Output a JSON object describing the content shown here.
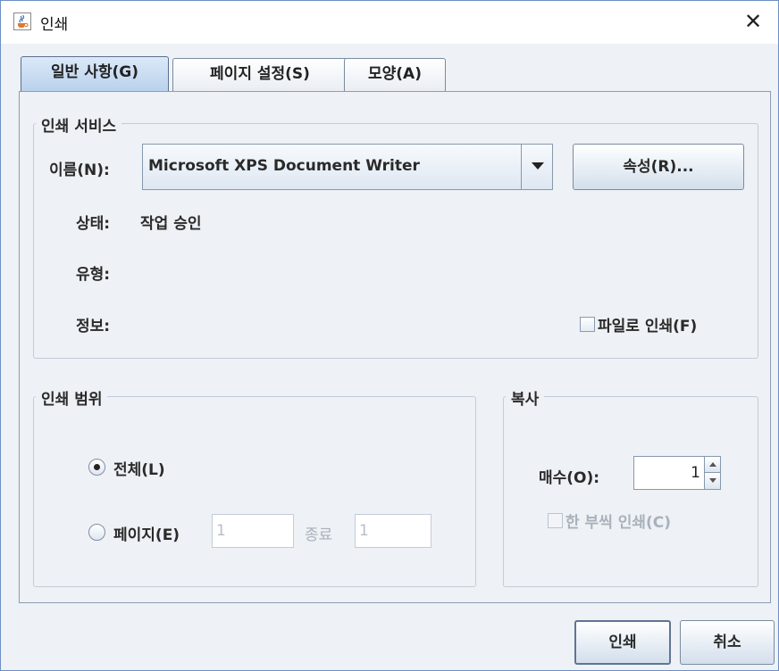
{
  "window": {
    "title": "인쇄",
    "close_symbol": "✕"
  },
  "tabs": [
    {
      "label": "일반 사항(G)",
      "active": true
    },
    {
      "label": "페이지 설정(S)",
      "active": false
    },
    {
      "label": "모양(A)",
      "active": false
    }
  ],
  "print_service": {
    "group_title": "인쇄 서비스",
    "name_label": "이름(N):",
    "printer_name": "Microsoft XPS Document Writer",
    "properties_button": "속성(R)...",
    "status_label": "상태:",
    "status_value": "작업 승인",
    "type_label": "유형:",
    "info_label": "정보:",
    "print_to_file_label": "파일로 인쇄(F)",
    "print_to_file_checked": false
  },
  "print_range": {
    "group_title": "인쇄 범위",
    "all_label": "전체(L)",
    "all_selected": true,
    "pages_label": "페이지(E)",
    "from_value": "1",
    "to_label": "종료",
    "to_value": "1"
  },
  "copies": {
    "group_title": "복사",
    "count_label": "매수(O):",
    "count_value": "1",
    "collate_label": "한 부씩 인쇄(C)",
    "collate_checked": false
  },
  "buttons": {
    "print": "인쇄",
    "cancel": "취소"
  },
  "colors": {
    "window_bg": "#eef1f5",
    "active_tab": "#c6dbf1",
    "border": "#8d9db3"
  },
  "icons": [
    "java-cup-icon",
    "close-icon",
    "dropdown-arrow-icon",
    "spinner-up-icon",
    "spinner-down-icon"
  ]
}
